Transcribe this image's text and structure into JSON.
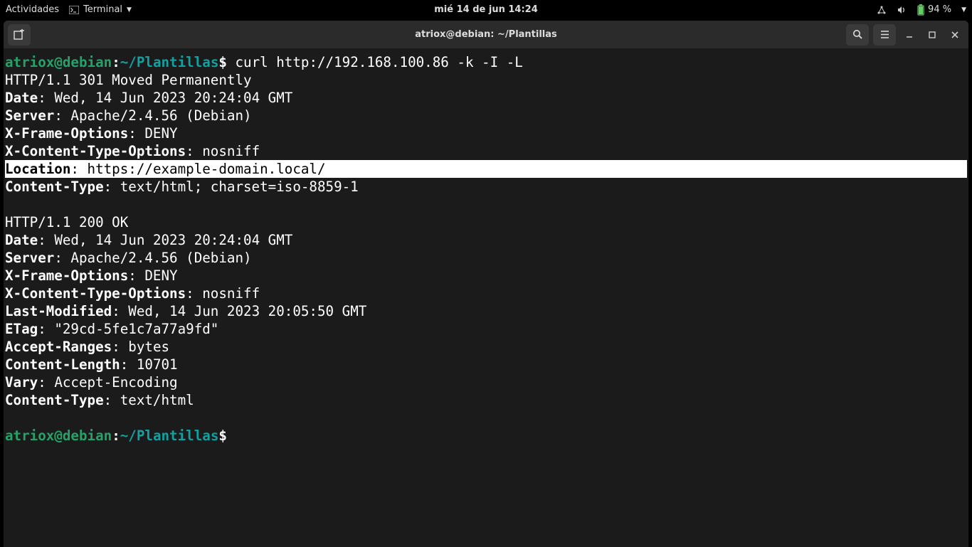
{
  "topbar": {
    "activities": "Actividades",
    "app_name": "Terminal",
    "datetime": "mié 14 de jun  14:24",
    "battery": "94 %"
  },
  "window": {
    "title": "atriox@debian: ~/Plantillas"
  },
  "prompt": {
    "user": "atriox@debian",
    "sep1": ":",
    "path": "~/Plantillas",
    "dollar": "$",
    "command": " curl http://192.168.100.86 -k -I -L"
  },
  "resp1": {
    "status": "HTTP/1.1 301 Moved Permanently",
    "date_k": "Date",
    "date_v": ": Wed, 14 Jun 2023 20:24:04 GMT",
    "server_k": "Server",
    "server_v": ": Apache/2.4.56 (Debian)",
    "xfo_k": "X-Frame-Options",
    "xfo_v": ": DENY",
    "xcto_k": "X-Content-Type-Options",
    "xcto_v": ": nosniff",
    "loc_k": "Location",
    "loc_v": ": https://example-domain.local/",
    "ct_k": "Content-Type",
    "ct_v": ": text/html; charset=iso-8859-1"
  },
  "resp2": {
    "status": "HTTP/1.1 200 OK",
    "date_k": "Date",
    "date_v": ": Wed, 14 Jun 2023 20:24:04 GMT",
    "server_k": "Server",
    "server_v": ": Apache/2.4.56 (Debian)",
    "xfo_k": "X-Frame-Options",
    "xfo_v": ": DENY",
    "xcto_k": "X-Content-Type-Options",
    "xcto_v": ": nosniff",
    "lm_k": "Last-Modified",
    "lm_v": ": Wed, 14 Jun 2023 20:05:50 GMT",
    "etag_k": "ETag",
    "etag_v": ": \"29cd-5fe1c7a77a9fd\"",
    "ar_k": "Accept-Ranges",
    "ar_v": ": bytes",
    "cl_k": "Content-Length",
    "cl_v": ": 10701",
    "vary_k": "Vary",
    "vary_v": ": Accept-Encoding",
    "ct_k": "Content-Type",
    "ct_v": ": text/html"
  },
  "prompt2": {
    "user": "atriox@debian",
    "sep1": ":",
    "path": "~/Plantillas",
    "dollar": "$"
  }
}
